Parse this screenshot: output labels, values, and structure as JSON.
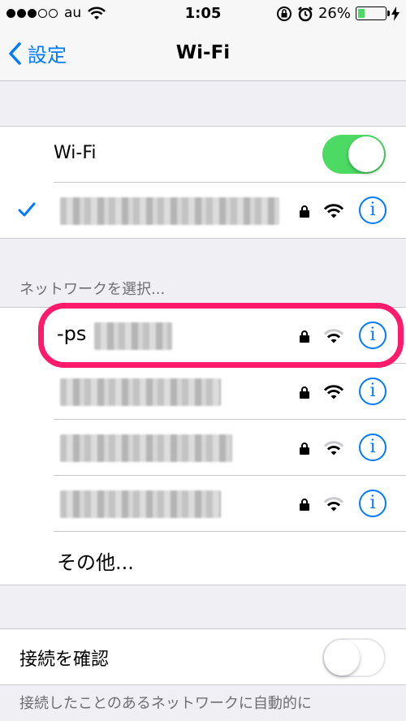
{
  "status_bar": {
    "carrier": "au",
    "time": "1:05",
    "battery_percent": "26%",
    "signal_strength": 3,
    "signal_total": 5,
    "battery_level": 0.26
  },
  "nav": {
    "back_label": "設定",
    "title": "Wi-Fi"
  },
  "wifi_toggle": {
    "label": "Wi-Fi",
    "on": true
  },
  "connected_network": {
    "name": "",
    "locked": true,
    "selected": true
  },
  "networks_section": {
    "header": "ネットワークを選択..."
  },
  "networks": [
    {
      "name": "-ps",
      "locked": true,
      "highlighted": true
    },
    {
      "name": "",
      "locked": true
    },
    {
      "name": "",
      "locked": true
    },
    {
      "name": "",
      "locked": true
    }
  ],
  "other_label": "その他...",
  "ask_to_join": {
    "label": "接続を確認",
    "on": false
  },
  "footer_text": "接続したことのあるネットワークに自動的に",
  "colors": {
    "accent": "#007aff",
    "toggle_on": "#4cd964",
    "highlight": "#ff1a6c",
    "background": "#efeff4"
  }
}
